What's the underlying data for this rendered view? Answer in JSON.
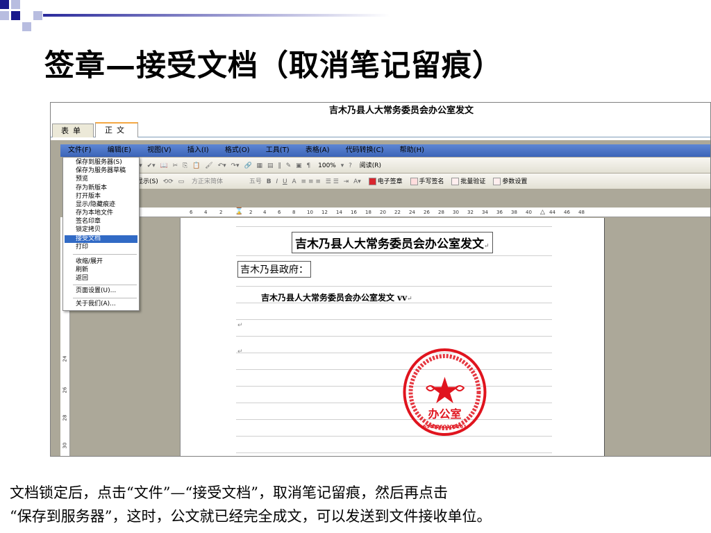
{
  "slide": {
    "title": "签章—接受文档（取消笔记留痕）",
    "caption_line1": "文档锁定后，点击“文件”—“接受文档”，取消笔记留痕，然后再点击",
    "caption_line2": "“保存到服务器”，这时，公文就已经完全成文，可以发送到文件接收单位。"
  },
  "window": {
    "doc_header": "吉木乃县人大常务委员会办公室发文",
    "tabs": [
      {
        "label": "表单"
      },
      {
        "label": "正文"
      }
    ],
    "menubar": [
      "文件(F)",
      "编辑(E)",
      "视图(V)",
      "插入(I)",
      "格式(O)",
      "工具(T)",
      "表格(A)",
      "代码转换(C)",
      "帮助(H)"
    ],
    "toolbar1": {
      "zoom": "100%",
      "read_label": "阅读(R)"
    },
    "toolbar2": {
      "show_label": "显示(S)",
      "font_name": "方正宋简体",
      "font_size": "五号",
      "sign_e": "电子签章",
      "sign_hand": "手写签名",
      "batch_verify": "批量验证",
      "params": "参数设置"
    },
    "ruler_left": [
      "6",
      "4",
      "2"
    ],
    "ruler_right": [
      "2",
      "4",
      "6",
      "8",
      "10",
      "12",
      "14",
      "16",
      "18",
      "20",
      "22",
      "24",
      "26",
      "28",
      "30",
      "32",
      "34",
      "36",
      "38",
      "40",
      "44",
      "46",
      "48"
    ],
    "vruler": [
      "24",
      "26",
      "28",
      "30"
    ]
  },
  "file_menu": {
    "items": [
      {
        "label": "保存到服务器(S)"
      },
      {
        "label": "保存为服务器草稿"
      },
      {
        "label": "预览"
      },
      {
        "label": "存为新版本"
      },
      {
        "label": "打开版本"
      },
      {
        "label": "显示/隐藏痕迹"
      },
      {
        "label": "存为本地文件"
      },
      {
        "label": "签名印章"
      },
      {
        "label": "锁定拷贝"
      },
      {
        "label": "接受文档",
        "selected": true
      },
      {
        "label": "打印"
      },
      {
        "label": "收缩/展开"
      },
      {
        "label": "刷新"
      },
      {
        "label": "返回"
      },
      {
        "label": "页面设置(U)..."
      },
      {
        "label": "关于我们(A)..."
      }
    ]
  },
  "document": {
    "title": "吉木乃县人大常务委员会办公室发文",
    "salutation": "吉木乃县政府：",
    "body": "吉木乃县人大常务委员会办公室发文 vv",
    "paragraph_mark": "↵",
    "seal_text": "办公室",
    "seal_number": "6543260105261"
  },
  "colors": {
    "menubar": "#3b64b8",
    "selection": "#316ac5",
    "seal": "#e0141e",
    "tab_accent": "#f4a742"
  }
}
